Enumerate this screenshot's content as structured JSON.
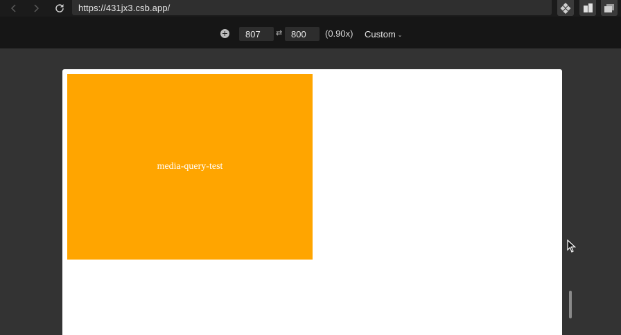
{
  "browser": {
    "url": "https://431jx3.csb.app/",
    "icons": {
      "back": "chevron-left-icon",
      "forward": "chevron-right-icon",
      "reload": "reload-icon",
      "codesandbox": "codesandbox-logo-icon",
      "split": "split-view-icon",
      "windows": "windows-icon"
    }
  },
  "responsive": {
    "width": "807",
    "height": "800",
    "swap_symbol": "⇄",
    "zoom": "(0.90x)",
    "preset": "Custom",
    "preset_chevron": "⌄"
  },
  "preview": {
    "box_text": "media-query-test",
    "box_color": "#ffa500"
  },
  "colors": {
    "chrome_bg": "#1b1b1b",
    "toolbar_bg": "#161616",
    "canvas_bg": "#333333",
    "input_bg": "#2d2d2d"
  }
}
